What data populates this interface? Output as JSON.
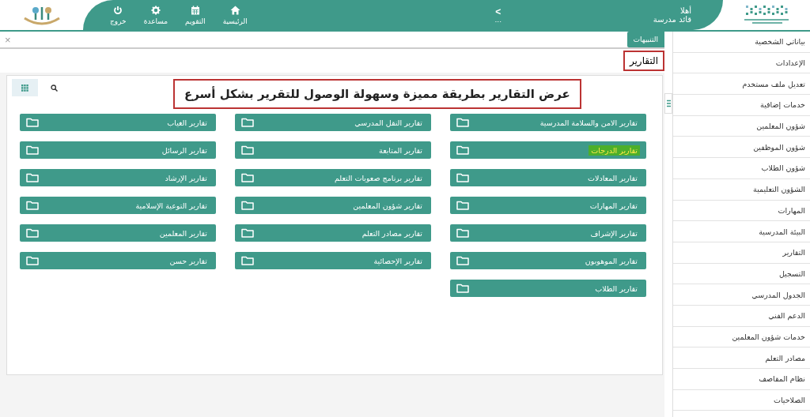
{
  "header": {
    "greeting": "أهلا",
    "role": "قائد مدرسة",
    "back": "<",
    "more": "...",
    "nav": [
      {
        "kind": "home",
        "label": "الرئيسية"
      },
      {
        "kind": "calendar",
        "label": "التقويم"
      },
      {
        "kind": "help",
        "label": "مساعدة"
      },
      {
        "kind": "logout",
        "label": "خروج"
      }
    ]
  },
  "alerts_tab": {
    "label": "التنبيهات",
    "close": "×"
  },
  "page_title": "التقارير",
  "headline": "عرض التقارير بطريقة مميزة وسهولة الوصول للتقرير بشكل أسرع",
  "reports": [
    {
      "label": "تقارير الامن والسلامة المدرسية",
      "highlighted": false
    },
    {
      "label": "تقارير النقل المدرسي",
      "highlighted": false
    },
    {
      "label": "تقارير الغياب",
      "highlighted": false
    },
    {
      "label": "تقارير الدرجات",
      "highlighted": true
    },
    {
      "label": "تقارير المتابعة",
      "highlighted": false
    },
    {
      "label": "تقارير الرسائل",
      "highlighted": false
    },
    {
      "label": "تقارير المعادلات",
      "highlighted": false
    },
    {
      "label": "تقارير برنامج صعوبات التعلم",
      "highlighted": false
    },
    {
      "label": "تقارير الإرشاد",
      "highlighted": false
    },
    {
      "label": "تقارير المهارات",
      "highlighted": false
    },
    {
      "label": "تقارير شؤون المعلمين",
      "highlighted": false
    },
    {
      "label": "تقارير التوعية الإسلامية",
      "highlighted": false
    },
    {
      "label": "تقارير الإشراف",
      "highlighted": false
    },
    {
      "label": "تقارير مصادر التعلم",
      "highlighted": false
    },
    {
      "label": "تقارير المعلمين",
      "highlighted": false
    },
    {
      "label": "تقارير الموهوبون",
      "highlighted": false
    },
    {
      "label": "تقارير الإحصائية",
      "highlighted": false
    },
    {
      "label": "تقارير حسن",
      "highlighted": false
    },
    {
      "label": "تقارير الطلاب",
      "highlighted": false
    }
  ],
  "sidebar": {
    "items": [
      "بياناتي الشخصية",
      "الإعدادات",
      "تعديل ملف مستخدم",
      "خدمات إضافية",
      "شؤون المعلمين",
      "شؤون الموظفين",
      "شؤون الطلاب",
      "الشؤون التعليمية",
      "المهارات",
      "البيئة المدرسية",
      "التقارير",
      "التسجيل",
      "الجدول المدرسي",
      "الدعم الفني",
      "خدمات شؤون المعلمين",
      "مصادر التعلم",
      "نظام المقاصف",
      "الصلاحيات"
    ]
  }
}
